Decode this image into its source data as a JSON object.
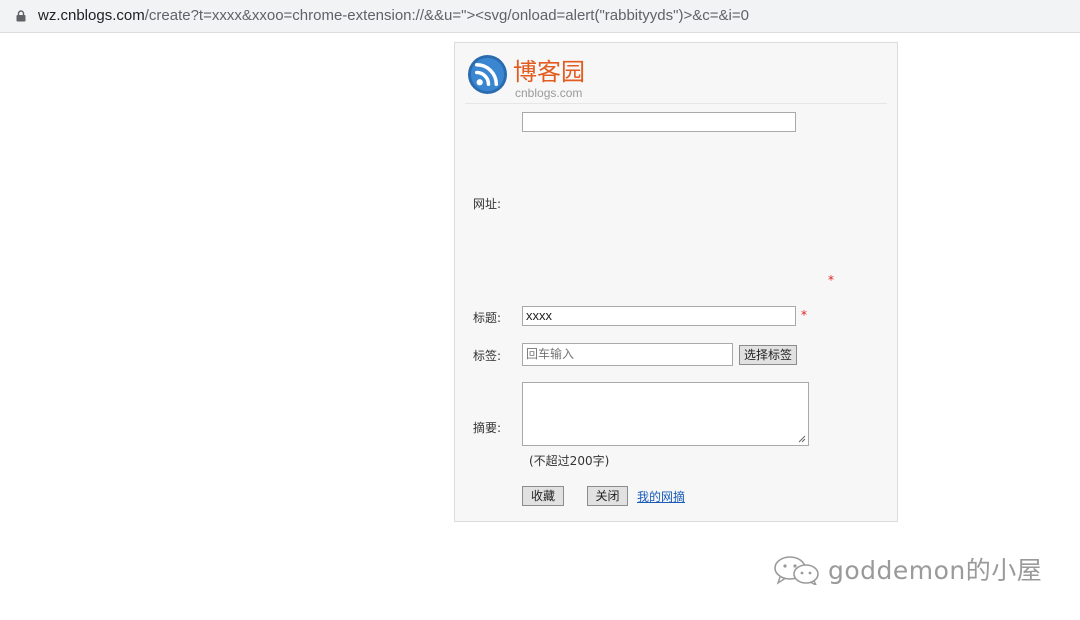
{
  "browser": {
    "url_host": "wz.cnblogs.com",
    "url_rest": "/create?t=xxxx&xxoo=chrome-extension://&&u=\"><svg/onload=alert(\"rabbityyds\")>&c=&i=0"
  },
  "logo": {
    "name": "博客园",
    "domain": "cnblogs.com"
  },
  "form": {
    "top_field_value": "",
    "url_label": "网址:",
    "title_label": "标题:",
    "title_value": "xxxx",
    "tags_label": "标签:",
    "tags_placeholder": "回车输入",
    "choose_tags_button": "选择标签",
    "summary_label": "摘要:",
    "summary_hint": "(不超过200字)",
    "required_mark": "*",
    "save_button": "收藏",
    "close_button": "关闭",
    "my_link": "我的网摘"
  },
  "watermark": {
    "text": "goddemon的小屋"
  },
  "colors": {
    "brand_orange": "#e25b1f",
    "link_blue": "#1a5bb8",
    "required_red": "#e02020"
  }
}
